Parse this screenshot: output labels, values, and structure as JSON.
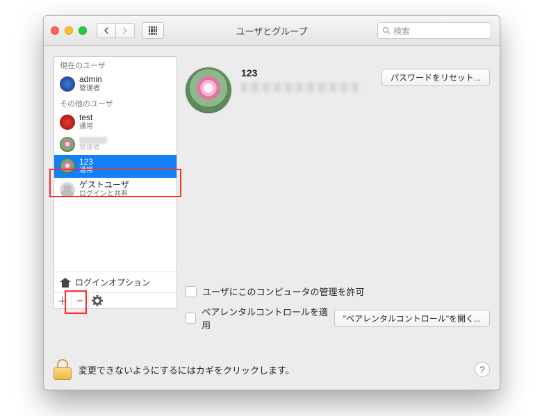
{
  "window": {
    "title": "ユーザとグループ",
    "search_placeholder": "検索"
  },
  "sidebar": {
    "current_header": "現在のユーザ",
    "other_header": "その他のユーザ",
    "login_options": "ログインオプション",
    "users": {
      "admin": {
        "name": "admin",
        "role": "管理者"
      },
      "test": {
        "name": "test",
        "role": "通常"
      },
      "hidden": {
        "name": "",
        "role": "管理者"
      },
      "selected": {
        "name": "123",
        "role": "通常"
      },
      "guest": {
        "name": "ゲストユーザ",
        "role": "ログインと共有"
      }
    },
    "tools": {
      "add": "＋",
      "remove": "−"
    }
  },
  "detail": {
    "username": "123",
    "reset_password": "パスワードをリセット...",
    "allow_admin": "ユーザにこのコンピュータの管理を許可",
    "parental_apply": "ペアレンタルコントロールを適用",
    "open_parental": "\"ペアレンタルコントロール\"を開く..."
  },
  "lock": {
    "message": "変更できないようにするにはカギをクリックします。",
    "help": "?"
  }
}
